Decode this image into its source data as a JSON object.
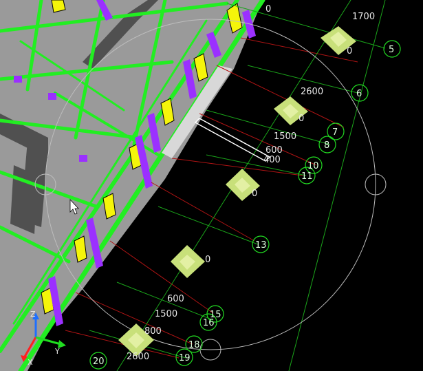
{
  "viewport": {
    "name": "cad-3d-model-view",
    "colors": {
      "background": "#000000",
      "slab": "#9a9a9a",
      "beam": "#22ee22",
      "wall": "#505050",
      "column_yellow": "#f5f50a",
      "column_purple": "#9b30ff",
      "pile_cap": "#c8e07a",
      "grid_line": "#1aa51a",
      "dim_line": "#b01414",
      "label_text": "#e8e8e8",
      "tag_circle": "#22dd22"
    }
  },
  "grid_tags": [
    "5",
    "6",
    "7",
    "8",
    "10",
    "11",
    "13",
    "15",
    "16",
    "18",
    "19",
    "20"
  ],
  "dimensions": [
    "1700",
    "2600",
    "1500",
    "600",
    "400",
    "600",
    "1500",
    "800",
    "2600"
  ],
  "pile_cap_labels": [
    "0",
    "0",
    "0",
    "0"
  ],
  "edge_label": "0",
  "axis_labels": {
    "z": "Z",
    "y": "Y",
    "x": "X"
  },
  "cursor": "arrow-cursor-icon"
}
